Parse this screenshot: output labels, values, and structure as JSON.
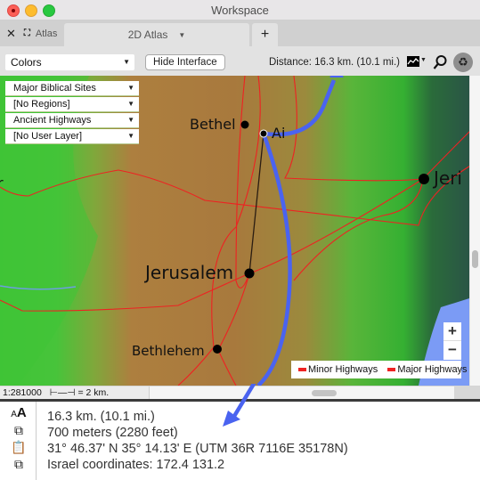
{
  "window": {
    "title": "Workspace"
  },
  "tabs": {
    "pane_label": "Atlas",
    "active": "2D Atlas",
    "add_label": "+"
  },
  "toolbar": {
    "color_mode": "Colors",
    "hide_interface_label": "Hide Interface",
    "distance": "Distance: 16.3 km. (10.1 mi.)",
    "icons": [
      "terrain-icon",
      "search-icon",
      "recycle-icon"
    ]
  },
  "layers": [
    {
      "label": "Major Biblical Sites"
    },
    {
      "label": "[No Regions]"
    },
    {
      "label": "Ancient Highways"
    },
    {
      "label": "[No User Layer]"
    }
  ],
  "map": {
    "places": [
      {
        "name": "Bethel"
      },
      {
        "name": "Ai"
      },
      {
        "name": "Jerusalem"
      },
      {
        "name": "Bethlehem"
      },
      {
        "name": "Jeri"
      },
      {
        "name": "r"
      }
    ],
    "legend": [
      {
        "label": "Minor Highways",
        "color": "#ee2222"
      },
      {
        "label": "Major Highways",
        "color": "#ee2222"
      }
    ],
    "zoom_in": "+",
    "zoom_out": "−",
    "route_color": "#4a63f0"
  },
  "status": {
    "scale_ratio": "1:281000",
    "scale_bar": "= 2 km."
  },
  "info": {
    "lines": [
      "16.3 km. (10.1 mi.)",
      "700 meters (2280 feet)",
      "31° 46.37' N  35° 14.13' E (UTM 36R 7116E 35178N)",
      "Israel coordinates: 172.4 131.2"
    ],
    "font_size_icon": "AA"
  }
}
